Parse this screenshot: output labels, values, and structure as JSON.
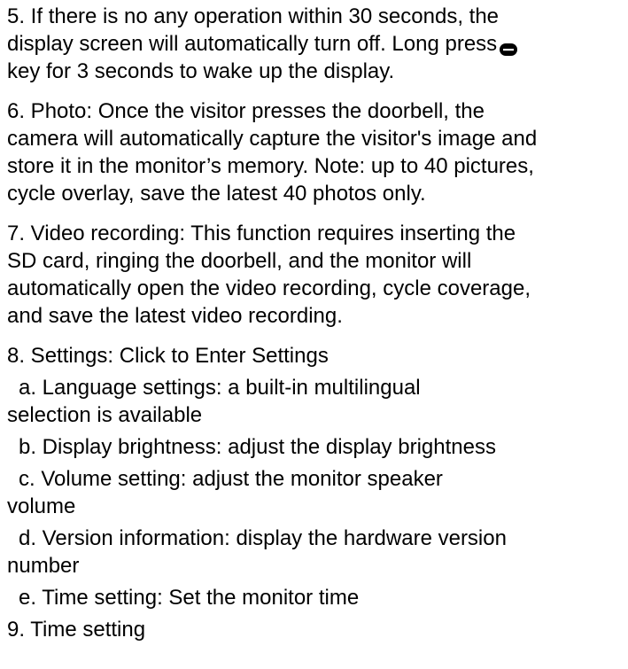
{
  "items": {
    "item5": {
      "line1": "5. If there is no any operation within 30 seconds, the",
      "line2_before_icon": "display screen will automatically turn off. Long press",
      "icon": "pill-key-icon",
      "line3": "key for 3 seconds to wake up the display."
    },
    "item6": {
      "line1": "6. Photo: Once the visitor presses the doorbell, the",
      "line2": "camera will automatically capture the visitor's image and",
      "line3": "store it in the monitor’s memory. Note: up to 40 pictures,",
      "line4": "cycle overlay, save the latest 40 photos only."
    },
    "item7": {
      "line1": "7. Video recording: This function requires inserting the",
      "line2": "SD card, ringing the doorbell, and the monitor will",
      "line3": "automatically open the video recording, cycle coverage,",
      "line4": "and save the latest video recording."
    },
    "item8": {
      "heading": "8. Settings: Click to Enter Settings",
      "sub_a_line1": "a. Language settings: a built-in multilingual",
      "sub_a_line2": "selection is available",
      "sub_b": "b. Display brightness: adjust the display brightness",
      "sub_c_line1": "c. Volume setting: adjust the monitor speaker",
      "sub_c_line2": "volume",
      "sub_d_line1": "d. Version information: display the hardware version",
      "sub_d_line2": "number",
      "sub_e": "e. Time setting: Set the monitor time"
    },
    "item9": {
      "heading": "9. Time setting"
    }
  }
}
